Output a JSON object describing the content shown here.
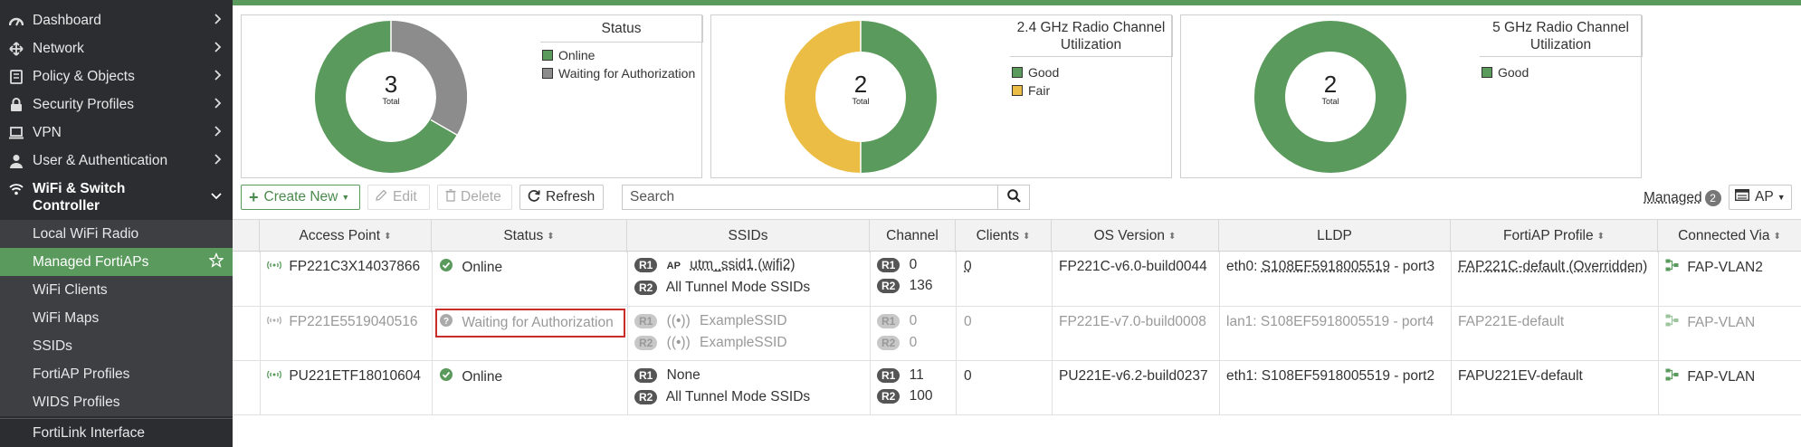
{
  "sidebar": {
    "items": [
      {
        "label": "Dashboard",
        "icon": "dashboard-icon"
      },
      {
        "label": "Network",
        "icon": "network-icon"
      },
      {
        "label": "Policy & Objects",
        "icon": "policy-icon"
      },
      {
        "label": "Security Profiles",
        "icon": "lock-icon"
      },
      {
        "label": "VPN",
        "icon": "vpn-icon"
      },
      {
        "label": "User & Authentication",
        "icon": "user-icon"
      }
    ],
    "active_section": {
      "label_line1": "WiFi & Switch",
      "label_line2": "Controller",
      "icon": "wifi-icon"
    },
    "sub_items": [
      "Local WiFi Radio",
      "Managed FortiAPs",
      "WiFi Clients",
      "WiFi Maps",
      "SSIDs",
      "FortiAP Profiles",
      "WIDS Profiles"
    ],
    "selected_sub_item": "Managed FortiAPs",
    "bottom_item": "FortiLink Interface"
  },
  "widgets": {
    "status": {
      "title": "Status",
      "total": "3",
      "total_label": "Total",
      "legend": [
        {
          "label": "Online",
          "color": "#5b9a5d"
        },
        {
          "label": "Waiting for Authorization",
          "color": "#8c8c8c"
        }
      ]
    },
    "radio24": {
      "title_line1": "2.4 GHz Radio Channel",
      "title_line2": "Utilization",
      "total": "2",
      "total_label": "Total",
      "legend": [
        {
          "label": "Good",
          "color": "#5b9a5d"
        },
        {
          "label": "Fair",
          "color": "#ecbd45"
        }
      ]
    },
    "radio5": {
      "title_line1": "5 GHz Radio Channel",
      "title_line2": "Utilization",
      "total": "2",
      "total_label": "Total",
      "legend": [
        {
          "label": "Good",
          "color": "#5b9a5d"
        }
      ]
    }
  },
  "toolbar": {
    "create_new": "Create New",
    "edit": "Edit",
    "delete": "Delete",
    "refresh": "Refresh",
    "search_placeholder": "Search",
    "managed_label": "Managed",
    "managed_count": "2",
    "view_label": "AP"
  },
  "table": {
    "headers": [
      "Access Point",
      "Status",
      "SSIDs",
      "Channel",
      "Clients",
      "OS Version",
      "LLDP",
      "FortiAP Profile",
      "Connected Via"
    ],
    "rows": [
      {
        "access_point": "FP221C3X14037866",
        "status": "Online",
        "ssid_r1": "utm_ssid1 (wifi2)",
        "ssid_r2": "All Tunnel Mode SSIDs",
        "channel_r1": "0",
        "channel_r2": "136",
        "clients": "0",
        "os_version": "FP221C-v6.0-build0044",
        "lldp_prefix": "eth0: ",
        "lldp_link": "S108EF5918005519",
        "lldp_suffix": " - port3",
        "profile": "FAP221C-default (Overridden)",
        "connected_via": "FAP-VLAN2"
      },
      {
        "access_point": "FP221E5519040516",
        "status": "Waiting for Authorization",
        "ssid_r1": "ExampleSSID",
        "ssid_r2": "ExampleSSID",
        "channel_r1": "0",
        "channel_r2": "0",
        "clients": "0",
        "os_version": "FP221E-v7.0-build0008",
        "lldp_prefix": "lan1: ",
        "lldp_link": "S108EF5918005519",
        "lldp_suffix": " - port4",
        "profile": "FAP221E-default",
        "connected_via": "FAP-VLAN"
      },
      {
        "access_point": "PU221ETF18010604",
        "status": "Online",
        "ssid_r1": "None",
        "ssid_r2": "All Tunnel Mode SSIDs",
        "channel_r1": "11",
        "channel_r2": "100",
        "clients": "0",
        "os_version": "PU221E-v6.2-build0237",
        "lldp_prefix": "eth1: ",
        "lldp_link": "S108EF5918005519",
        "lldp_suffix": " - port2",
        "profile": "FAPU221EV-default",
        "connected_via": "FAP-VLAN"
      }
    ],
    "radio_labels": [
      "R1",
      "R2"
    ]
  },
  "colors": {
    "accent": "#5b9a5d",
    "waiting": "#8c8c8c",
    "fair": "#ecbd45",
    "highlight_border": "#cc2b2b"
  }
}
